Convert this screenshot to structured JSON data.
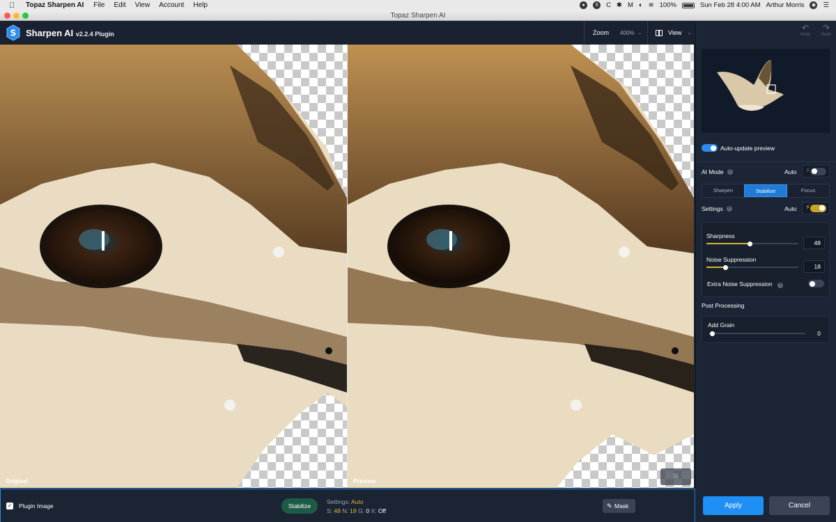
{
  "menubar": {
    "app_name": "Topaz Sharpen AI",
    "items": [
      "File",
      "Edit",
      "View",
      "Account",
      "Help"
    ],
    "right": {
      "battery": "100%",
      "datetime": "Sun Feb 28  4:00 AM",
      "user": "Arthur Morris"
    }
  },
  "window": {
    "title": "Topaz Sharpen AI"
  },
  "header": {
    "product": "Sharpen AI",
    "version": "v2.2.4 Plugin",
    "zoom_label": "Zoom",
    "zoom_value": "400%",
    "view_label": "View"
  },
  "panes": {
    "left_label": "Original",
    "right_label": "Preview"
  },
  "sidebar": {
    "undo_label": "Undo",
    "redo_label": "Redo",
    "auto_update_label": "Auto-update preview",
    "ai_mode_label": "AI Mode",
    "auto_label": "Auto",
    "modes": [
      "Sharpen",
      "Stabilize",
      "Focus"
    ],
    "active_mode": "Stabilize",
    "settings_label": "Settings",
    "sharpness_label": "Sharpness",
    "sharpness_value": "48",
    "noise_label": "Noise Suppression",
    "noise_value": "18",
    "extra_noise_label": "Extra Noise Suppression",
    "post_processing_label": "Post Processing",
    "grain_label": "Add Grain",
    "grain_value": "0"
  },
  "bottombar": {
    "plugin_image_label": "Plugin Image",
    "mode_pill": "Stabilize",
    "settings_prefix": "Settings:",
    "settings_mode": "Auto",
    "s_label": "S:",
    "s_value": "48",
    "n_label": "N:",
    "n_value": "18",
    "g_label": "G:",
    "g_value": "0",
    "x_label": "X:",
    "x_value": "Off",
    "mask_label": "Mask"
  },
  "buttons": {
    "apply": "Apply",
    "cancel": "Cancel"
  },
  "colors": {
    "accent": "#1d8ff5",
    "gold": "#d9b43a",
    "panel": "#1c2535"
  }
}
